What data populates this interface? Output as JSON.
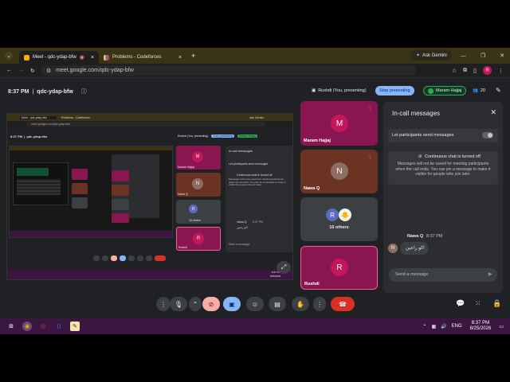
{
  "browser": {
    "tabs": [
      {
        "label": "Meet - qdc-ydap-bfw"
      },
      {
        "label": "Problems - Codeforces"
      }
    ],
    "new_tab": "+",
    "url": "meet.google.com/qdc-ydap-bfw",
    "ask_gemini": "Ask Gemini",
    "avatar_initial": "R",
    "win_min": "—",
    "win_max": "❐",
    "win_close": "✕",
    "close_tab": "×"
  },
  "meet": {
    "time": "8:37 PM",
    "separator": "|",
    "meeting_code": "qdc-ydap-bfw",
    "presenting_label": "Rushdi (You, presenting)",
    "stop_presenting": "Stop presenting",
    "spotlight_name": "Maram Hajjaj",
    "participant_count": "20"
  },
  "tiles": [
    {
      "name": "Maram Hajjaj",
      "initial": "M"
    },
    {
      "name": "Nawa Q",
      "initial": "N"
    },
    {
      "name": "16 others",
      "initials": [
        "R",
        "🐥"
      ]
    },
    {
      "name": "Rushdi",
      "initial": "R"
    }
  ],
  "shared_screen": {
    "time": "8:37 PM",
    "separator": "|",
    "meeting_code": "qdc-ydap-bfw",
    "url": "meet.google.com/qdc-ydap-bfw",
    "tab_meet": "Meet - qdc-ydap-bfw",
    "tab_problems": "Problems - Codeforces",
    "ask_gemini": "Ask Gemini",
    "presenting_label": "Rushdi (You, presenting)",
    "stop_presenting": "Stop presenting",
    "spotlight_name": "Maram Hajjaj",
    "panel_title": "In-call messages",
    "let_send": "Let participants send messages",
    "continuous_chat": "Continuous chat is turned off",
    "notice": "Messages will not be saved for meeting participants when the call ends. You can pin a message to make it visible for people who join later.",
    "sender": "Nawa Q",
    "sent_time": "8:37 PM",
    "message": "اكو راعين",
    "placeholder": "Send a message",
    "tile_names": [
      "Maram Hajjaj",
      "Nawa Q",
      "16 others",
      "Rushdi"
    ],
    "tile_initials": [
      "M",
      "N",
      "R",
      "R"
    ],
    "tray_time": "8:37 PM",
    "tray_date": "8/25/2026"
  },
  "chat": {
    "title": "In-call messages",
    "let_participants_send": "Let participants send messages",
    "continuous_chat_title": "Continuous chat is turned off",
    "continuous_chat_body": "Messages will not be saved for meeting participants when the call ends. You can pin a message to make it visible for people who join later.",
    "message_sender": "Nawa Q",
    "message_time": "8:37 PM",
    "message_text": "اكو راعين",
    "sender_initial": "N",
    "input_placeholder": "Send a message"
  },
  "taskbar": {
    "language": "ENG",
    "time": "8:37 PM",
    "date": "8/25/2026"
  },
  "colors": {
    "tile_magenta": "#8a1651",
    "tile_brown": "#6b3322",
    "tile_gray": "#3c4043",
    "accent_blue": "#8ab4f8",
    "end_call_red": "#d93025",
    "taskbar_purple": "#3b1640"
  }
}
